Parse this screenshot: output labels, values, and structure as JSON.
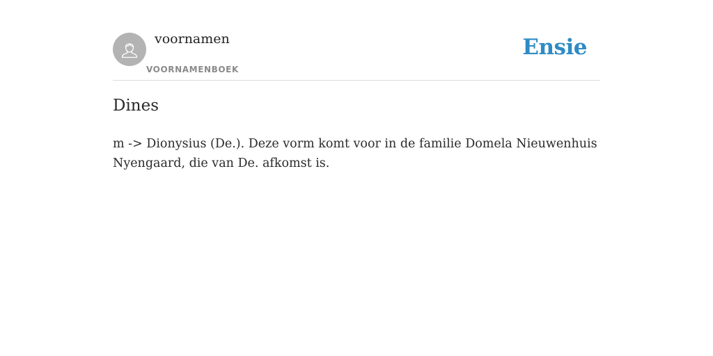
{
  "header": {
    "username": "voornamen",
    "category": "VOORNAMENBOEK",
    "brand": "Ensie",
    "avatar_icon": "user-avatar-icon",
    "brand_color": "#2f8bc4"
  },
  "entry": {
    "title": "Dines",
    "definition": "m -> Dionysius (De.). Deze vorm komt voor in de familie Domela Nieuwenhuis Nyengaard, die van De. afkomst is."
  }
}
